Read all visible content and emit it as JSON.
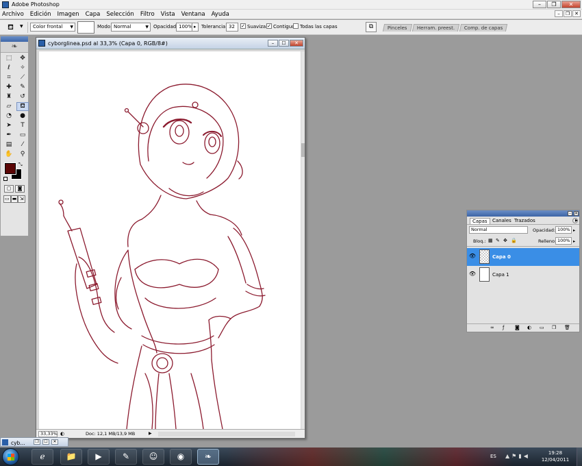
{
  "app": {
    "title": "Adobe Photoshop"
  },
  "menu": [
    "Archivo",
    "Edición",
    "Imagen",
    "Capa",
    "Selección",
    "Filtro",
    "Vista",
    "Ventana",
    "Ayuda"
  ],
  "options": {
    "fill_source": "Color frontal",
    "mode_label": "Modo:",
    "mode_value": "Normal",
    "opacity_label": "Opacidad:",
    "opacity_value": "100%",
    "tolerance_label": "Tolerancia:",
    "tolerance_value": "32",
    "antialias_label": "Suavizar",
    "contiguous_label": "Contiguo",
    "all_layers_label": "Todas las capas",
    "antialias_checked": true,
    "contiguous_checked": true,
    "all_layers_checked": false
  },
  "palette_well": [
    "Pinceles",
    "Herram. preest.",
    "Comp. de capas"
  ],
  "document": {
    "title": "cyborglinea.psd al 33,3% (Capa 0, RGB/8#)",
    "zoom": "33,33%",
    "doc_size": "Doc: 12,1 MB/13,9 MB",
    "line_color": "#8b1a2e"
  },
  "colors": {
    "foreground": "#5b0606",
    "background": "#000000"
  },
  "layers_panel": {
    "tabs": [
      "Capas",
      "Canales",
      "Trazados"
    ],
    "blend_mode": "Normal",
    "opacity_label": "Opacidad:",
    "opacity_value": "100%",
    "lock_label": "Bloq.:",
    "fill_label": "Relleno:",
    "fill_value": "100%",
    "layers": [
      {
        "name": "Capa 0",
        "selected": true
      },
      {
        "name": "Capa 1",
        "selected": false
      }
    ]
  },
  "minimized_doc": {
    "title": "cyb..."
  },
  "taskbar": {
    "language": "ES",
    "time": "19:28",
    "date": "12/04/2011"
  },
  "icons": {
    "start": "windows-start-icon",
    "ie": "internet-explorer-icon",
    "explorer": "folder-icon",
    "media": "media-player-icon",
    "chrome": "chrome-icon",
    "photoshop": "photoshop-feather-icon"
  }
}
